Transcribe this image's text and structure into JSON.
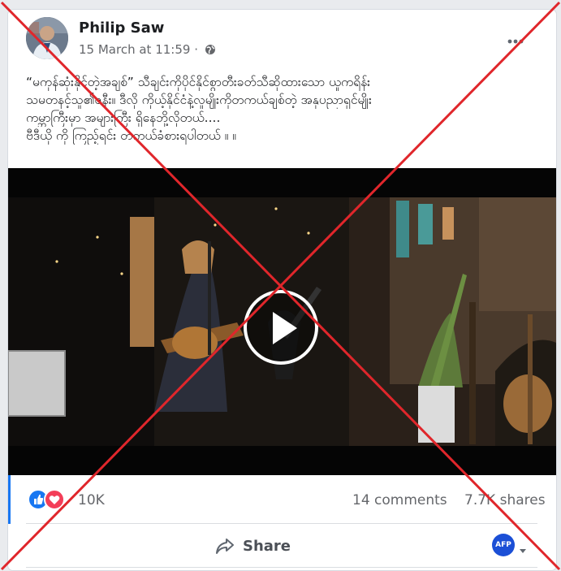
{
  "post": {
    "author": "Philip Saw",
    "timestamp": "15 March at 11:59",
    "separator": " · ",
    "text_lines": [
      "“မကုန်ဆုံးနိုင်တဲ့အချစ်” သီချင်းကိုပိုင်နိုင်စွာတီးခတ်သီဆိုထားသော ယူကရိန်း",
      "သမတနင့်သူ၏ဇနီး။ ဒီလို ကိုယ့်နိုင်ငံနဲ့လူမျိုးကိုတကယ်ချစ်တဲ့ အနုပညာရှင်မျိုး",
      "ကမ္ဘာကြီးမှာ အများကြီး ရှိနေဘို့လိုတယ်....",
      "ဗီဒီယို ကို ကြည့်ရင်း တကယ်ခံစားရပါတယ် ။ ။"
    ]
  },
  "video": {
    "play_icon": "play-icon"
  },
  "stats": {
    "reactions_count": "10K",
    "comments": "14 comments",
    "shares": "7.7K shares"
  },
  "actions": {
    "share_label": "Share",
    "page_badge": "AFP"
  },
  "overlay": {
    "color": "#e0262b"
  },
  "colors": {
    "accent": "#1877f2",
    "like": "#1877f2",
    "love": "#f33e58"
  }
}
